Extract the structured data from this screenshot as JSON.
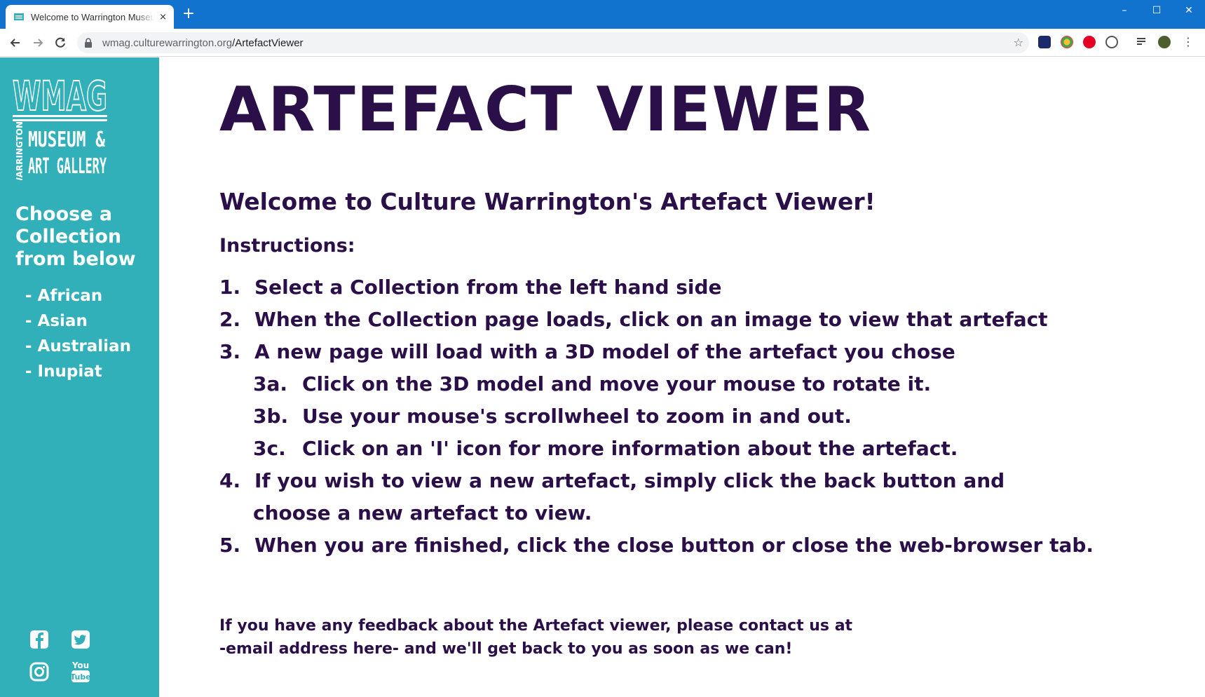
{
  "browser": {
    "tab_title": "Welcome to Warrington Museum & Art Gallery",
    "tab_close": "×",
    "new_tab": "+",
    "url_host": "wmag.culturewarrington.org",
    "url_path": "/ArtefactViewer",
    "window_controls": {
      "minimize": "–",
      "maximize": "☐",
      "close": "✕"
    },
    "accent_color": "#1273cf"
  },
  "sidebar": {
    "background": "#32b0b9",
    "logo_text": [
      "WMAG",
      "WARRINGTON",
      "MUSEUM &",
      "ART GALLERY"
    ],
    "heading": "Choose a Collection from below",
    "collections": [
      "- African",
      "- Asian",
      "- Australian",
      "- Inupiat"
    ],
    "social_icons": [
      "facebook-icon",
      "twitter-icon",
      "instagram-icon",
      "youtube-icon"
    ]
  },
  "main": {
    "title": "ARTEFACT VIEWER",
    "welcome": "Welcome to Culture Warrington's Artefact Viewer!",
    "instructions_heading": "Instructions:",
    "steps": [
      {
        "num": "1.",
        "text": "Select a Collection from the left hand side"
      },
      {
        "num": "2.",
        "text": "When the Collection page loads, click on an image to view that artefact"
      },
      {
        "num": "3.",
        "text": "A new page will load with a 3D model of the artefact you chose"
      },
      {
        "num": "3a.",
        "text": "Click on the 3D model and move your mouse to rotate it."
      },
      {
        "num": "3b.",
        "text": "Use your mouse's scrollwheel to zoom in and out."
      },
      {
        "num": "3c.",
        "text": "Click on an 'I' icon for more information about the artefact."
      },
      {
        "num": "4.",
        "text": "If you wish to view a new artefact, simply click the back button and"
      },
      {
        "num": "",
        "text": "choose a new artefact to view."
      },
      {
        "num": "5.",
        "text": "When you are finished, click the close button or close the web-browser tab."
      }
    ],
    "feedback_line1": "If you have any feedback about the Artefact viewer, please contact us at",
    "feedback_line2": "-email address here- and we'll get back to you as soon as we can!",
    "text_color": "#2a0f48"
  }
}
